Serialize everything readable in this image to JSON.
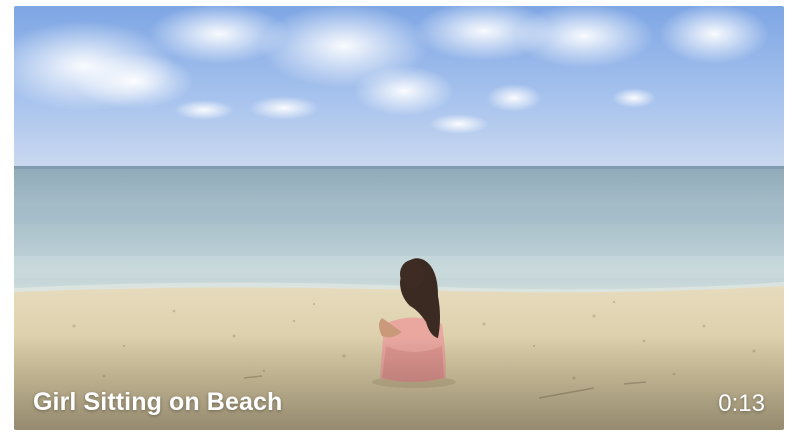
{
  "video": {
    "title": "Girl Sitting on Beach",
    "duration": "0:13"
  },
  "icons": {
    "thumbnail": "beach-scene-thumbnail"
  },
  "colors": {
    "overlay_text": "#ffffff",
    "sky": "#8fb1e6",
    "sea": "#a9c4cf",
    "sand": "#d9cca8"
  }
}
